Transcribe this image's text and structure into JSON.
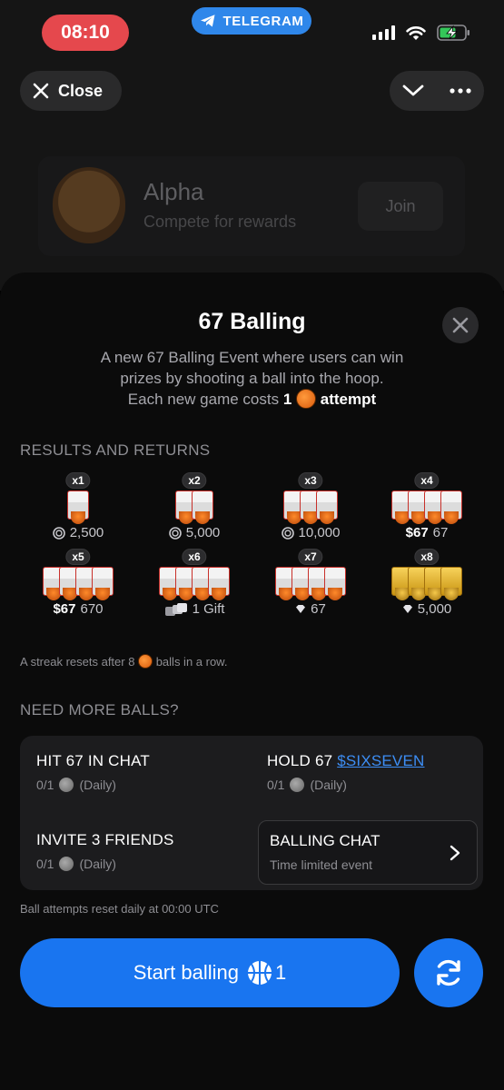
{
  "status": {
    "time": "08:10",
    "app_pill": "TELEGRAM"
  },
  "topbar": {
    "close_label": "Close"
  },
  "background_card": {
    "title": "Alpha",
    "subtitle": "Compete for rewards",
    "join_label": "Join"
  },
  "sheet": {
    "title": "67 Balling",
    "desc_line1": "A new 67 Balling Event where users can win",
    "desc_line2": "prizes by shooting a ball into the hoop.",
    "desc_line3_pre": "Each new game costs",
    "desc_cost": "1",
    "desc_line3_post": "attempt"
  },
  "results": {
    "section_label": "RESULTS AND RETURNS",
    "items": [
      {
        "mult": "x1",
        "hoops": 1,
        "icon": "coin-icon",
        "prefix": "",
        "value": "2,500"
      },
      {
        "mult": "x2",
        "hoops": 2,
        "icon": "coin-icon",
        "prefix": "",
        "value": "5,000"
      },
      {
        "mult": "x3",
        "hoops": 3,
        "icon": "coin-icon",
        "prefix": "",
        "value": "10,000"
      },
      {
        "mult": "x4",
        "hoops": 4,
        "icon": "",
        "prefix": "$67",
        "value": "67"
      },
      {
        "mult": "x5",
        "hoops": 5,
        "icon": "",
        "prefix": "$67",
        "value": "670"
      },
      {
        "mult": "x6",
        "hoops": 6,
        "icon": "gift-icon",
        "prefix": "",
        "value": "1 Gift"
      },
      {
        "mult": "x7",
        "hoops": 7,
        "icon": "diamond-icon",
        "prefix": "",
        "value": "67"
      },
      {
        "mult": "x8",
        "hoops": 8,
        "icon": "diamond-icon",
        "prefix": "",
        "value": "5,000"
      }
    ],
    "streak_pre": "A streak resets after 8",
    "streak_post": "balls in a row."
  },
  "more": {
    "section_label": "NEED MORE BALLS?",
    "task1_title": "HIT 67 IN CHAT",
    "task1_progress": "0/1",
    "task1_period": "(Daily)",
    "task2_title_pre": "HOLD 67",
    "task2_link": "$SIXSEVEN",
    "task2_progress": "0/1",
    "task2_period": "(Daily)",
    "task3_title": "INVITE 3 FRIENDS",
    "task3_progress": "0/1",
    "task3_period": "(Daily)",
    "chat_title": "BALLING CHAT",
    "chat_sub": "Time limited event"
  },
  "footer": {
    "reset_note": "Ball attempts reset daily at 00:00 UTC",
    "start_label": "Start balling",
    "start_count": "1"
  },
  "colors": {
    "accent": "#1975f0",
    "link": "#3d8ef5",
    "time_pill": "#e5484d"
  }
}
